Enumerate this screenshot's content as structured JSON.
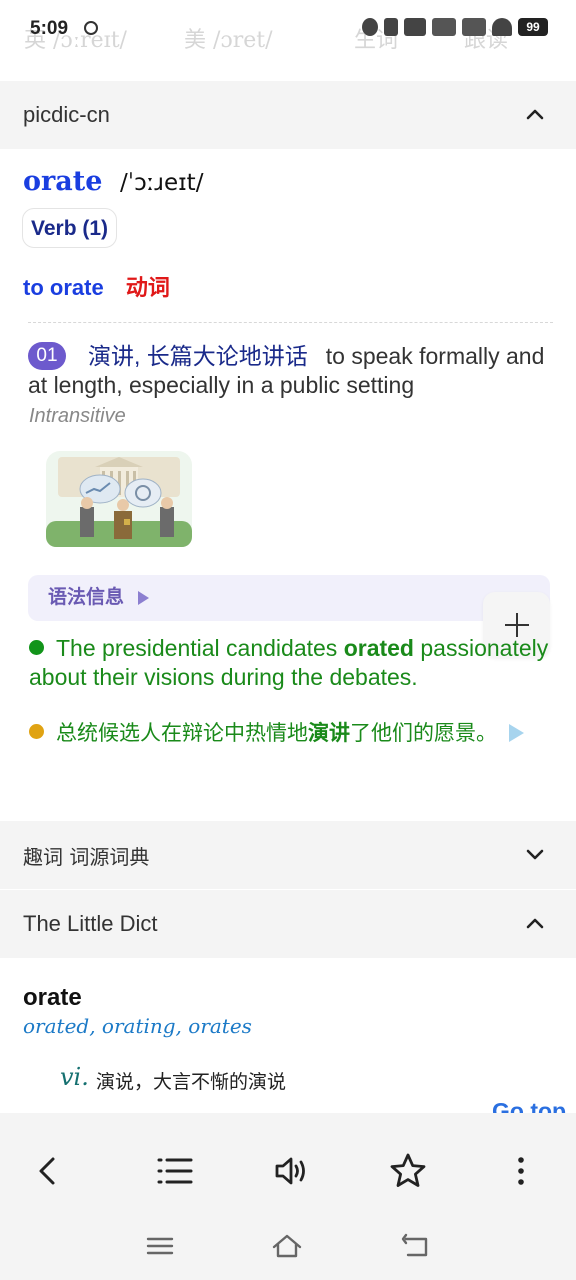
{
  "status_bar": {
    "time": "5:09",
    "battery": "99",
    "faded_text": {
      "uk": "英 /ɔːreɪt/",
      "us": "美 /ɔret/",
      "add": "生词",
      "follow": "跟读"
    }
  },
  "sections": {
    "picdic": {
      "title": "picdic-cn",
      "headword": "orate",
      "ipa": "/ˈɔːɹeɪt/",
      "pos_chip": "Verb (1)",
      "sense_en": "to orate",
      "sense_zh": "动词",
      "definition": {
        "number": "01",
        "zh": "演讲, 长篇大论地讲话",
        "en": "to speak formally and at length, especially in a public setting"
      },
      "usage": "Intransitive",
      "grammar_label": "语法信息",
      "example": {
        "en_before": "The presidential candidates ",
        "en_bold": "orated",
        "en_after": " passionately about their visions during the debates.",
        "zh_before": "总统候选人在辩论中热情地",
        "zh_bold": "演讲",
        "zh_after": "了他们的愿景。"
      }
    },
    "quci": {
      "title": "趣词 词源词典"
    },
    "little_dict": {
      "title": "The Little Dict",
      "headword": "orate",
      "forms": "orated, orating, orates",
      "pos": "vi.",
      "meaning": "演说，大言不惭的演说",
      "go_top": "Go top"
    }
  },
  "toolbar": {
    "buttons": [
      "back-icon",
      "list-icon",
      "speaker-icon",
      "star-icon",
      "more-icon"
    ]
  },
  "colors": {
    "headword": "#1a3ee0",
    "sense_zh": "#e01818",
    "badge": "#6d5acd",
    "example": "#1a8a1a",
    "forms": "#1c7ac7"
  }
}
